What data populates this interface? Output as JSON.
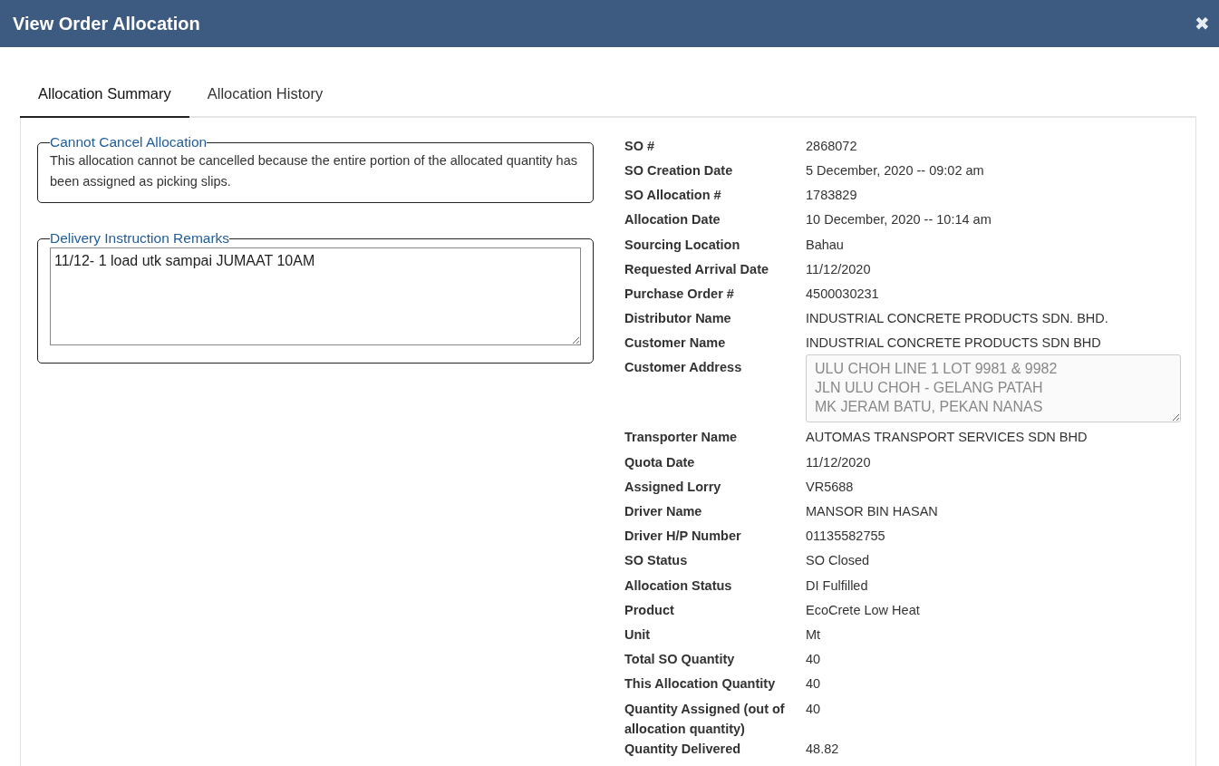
{
  "window": {
    "title": "View Order Allocation",
    "close": "✖"
  },
  "tabs": [
    {
      "label": "Allocation Summary",
      "selected": true
    },
    {
      "label": "Allocation History",
      "selected": false
    }
  ],
  "notice": {
    "legend": "Cannot Cancel Allocation",
    "text": "This allocation cannot be cancelled because the entire portion of the allocated quantity has been assigned as picking slips."
  },
  "remarks": {
    "legend": "Delivery Instruction Remarks",
    "value": "11/12- 1 load utk sampai JUMAAT 10AM"
  },
  "details": [
    {
      "kind": "text",
      "label": "SO #",
      "value": "2868072"
    },
    {
      "kind": "text",
      "label": "SO Creation Date",
      "value": "5 December, 2020 -- 09:02 am"
    },
    {
      "kind": "text",
      "label": "SO Allocation #",
      "value": "1783829"
    },
    {
      "kind": "text",
      "label": "Allocation Date",
      "value": "10 December, 2020 -- 10:14 am"
    },
    {
      "kind": "text",
      "label": "Sourcing Location",
      "value": "Bahau"
    },
    {
      "kind": "text",
      "label": "Requested Arrival Date",
      "value": "11/12/2020"
    },
    {
      "kind": "text",
      "label": "Purchase Order #",
      "value": "4500030231"
    },
    {
      "kind": "text",
      "label": "Distributor Name",
      "value": "INDUSTRIAL CONCRETE PRODUCTS SDN. BHD."
    },
    {
      "kind": "text",
      "label": "Customer Name",
      "value": "INDUSTRIAL CONCRETE PRODUCTS SDN BHD"
    },
    {
      "kind": "textarea",
      "label": "Customer Address",
      "value": "ULU CHOH LINE 1 LOT 9981 & 9982\nJLN ULU CHOH - GELANG PATAH\nMK JERAM BATU, PEKAN NANAS"
    },
    {
      "kind": "text",
      "label": "Transporter Name",
      "value": "AUTOMAS TRANSPORT SERVICES SDN BHD"
    },
    {
      "kind": "text",
      "label": "Quota Date",
      "value": "11/12/2020"
    },
    {
      "kind": "text",
      "label": "Assigned Lorry",
      "value": "VR5688"
    },
    {
      "kind": "text",
      "label": "Driver Name",
      "value": "MANSOR BIN HASAN"
    },
    {
      "kind": "text",
      "label": "Driver H/P Number",
      "value": "01135582755"
    },
    {
      "kind": "text",
      "label": "SO Status",
      "value": "SO Closed"
    },
    {
      "kind": "text",
      "label": "Allocation Status",
      "value": "DI Fulfilled"
    },
    {
      "kind": "text",
      "label": "Product",
      "value": "EcoCrete Low Heat"
    },
    {
      "kind": "text",
      "label": "Unit",
      "value": "Mt"
    },
    {
      "kind": "text",
      "label": "Total SO Quantity",
      "value": "40"
    },
    {
      "kind": "text",
      "label": "This Allocation Quantity",
      "value": "40"
    },
    {
      "kind": "text",
      "label": "Quantity Assigned (out of allocation quantity)",
      "value": "40"
    },
    {
      "kind": "text",
      "label": "Quantity Delivered",
      "value": "48.82"
    }
  ]
}
